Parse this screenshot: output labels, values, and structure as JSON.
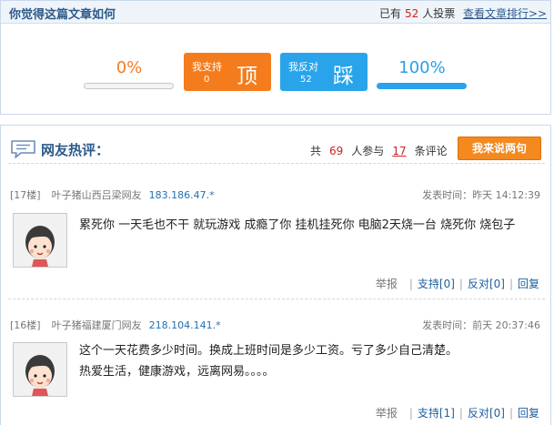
{
  "vote": {
    "title": "你觉得这篇文章如何",
    "count_prefix": "已有",
    "count": "52",
    "count_suffix": "人投票",
    "rank_link": "查看文章排行>>",
    "support": {
      "percent_text": "0%",
      "percent": 0,
      "label": "我支持",
      "count": "0",
      "big_char": "顶"
    },
    "oppose": {
      "percent_text": "100%",
      "percent": 100,
      "label": "我反对",
      "count": "52",
      "big_char": "踩"
    }
  },
  "comments": {
    "title": "网友热评：",
    "stats_prefix": "共",
    "participants": "69",
    "stats_middle": "人参与",
    "comment_count": "17",
    "stats_suffix": "条评论",
    "post_button": "我来说两句",
    "items": [
      {
        "floor": "[17楼]",
        "user": "叶子猪山西吕梁网友",
        "ip": "183.186.47.*",
        "time": "发表时间：昨天 14:12:39",
        "text": "累死你  一天毛也不干  就玩游戏 成瘾了你  挂机挂死你  电脑2天烧一台  烧死你  烧包子",
        "report": "举报",
        "support": "支持[0]",
        "oppose": "反对[0]",
        "reply": "回复"
      },
      {
        "floor": "[16楼]",
        "user": "叶子猪福建厦门网友",
        "ip": "218.104.141.*",
        "time": "发表时间：前天 20:37:46",
        "text": "这个一天花费多少时间。换成上班时间是多少工资。亏了多少自己清楚。\n热爱生活，健康游戏，远离网易。。。。",
        "report": "举报",
        "support": "支持[1]",
        "oppose": "反对[0]",
        "reply": "回复"
      }
    ]
  },
  "colors": {
    "support": "#f47c1c",
    "oppose": "#29a4ea",
    "title_blue": "#2d5a8a",
    "count_red": "#cc2222",
    "post_button": "#f4891f"
  },
  "icons": {
    "comments": "speech-bubble-icon",
    "avatar": "cartoon-face-avatar"
  }
}
